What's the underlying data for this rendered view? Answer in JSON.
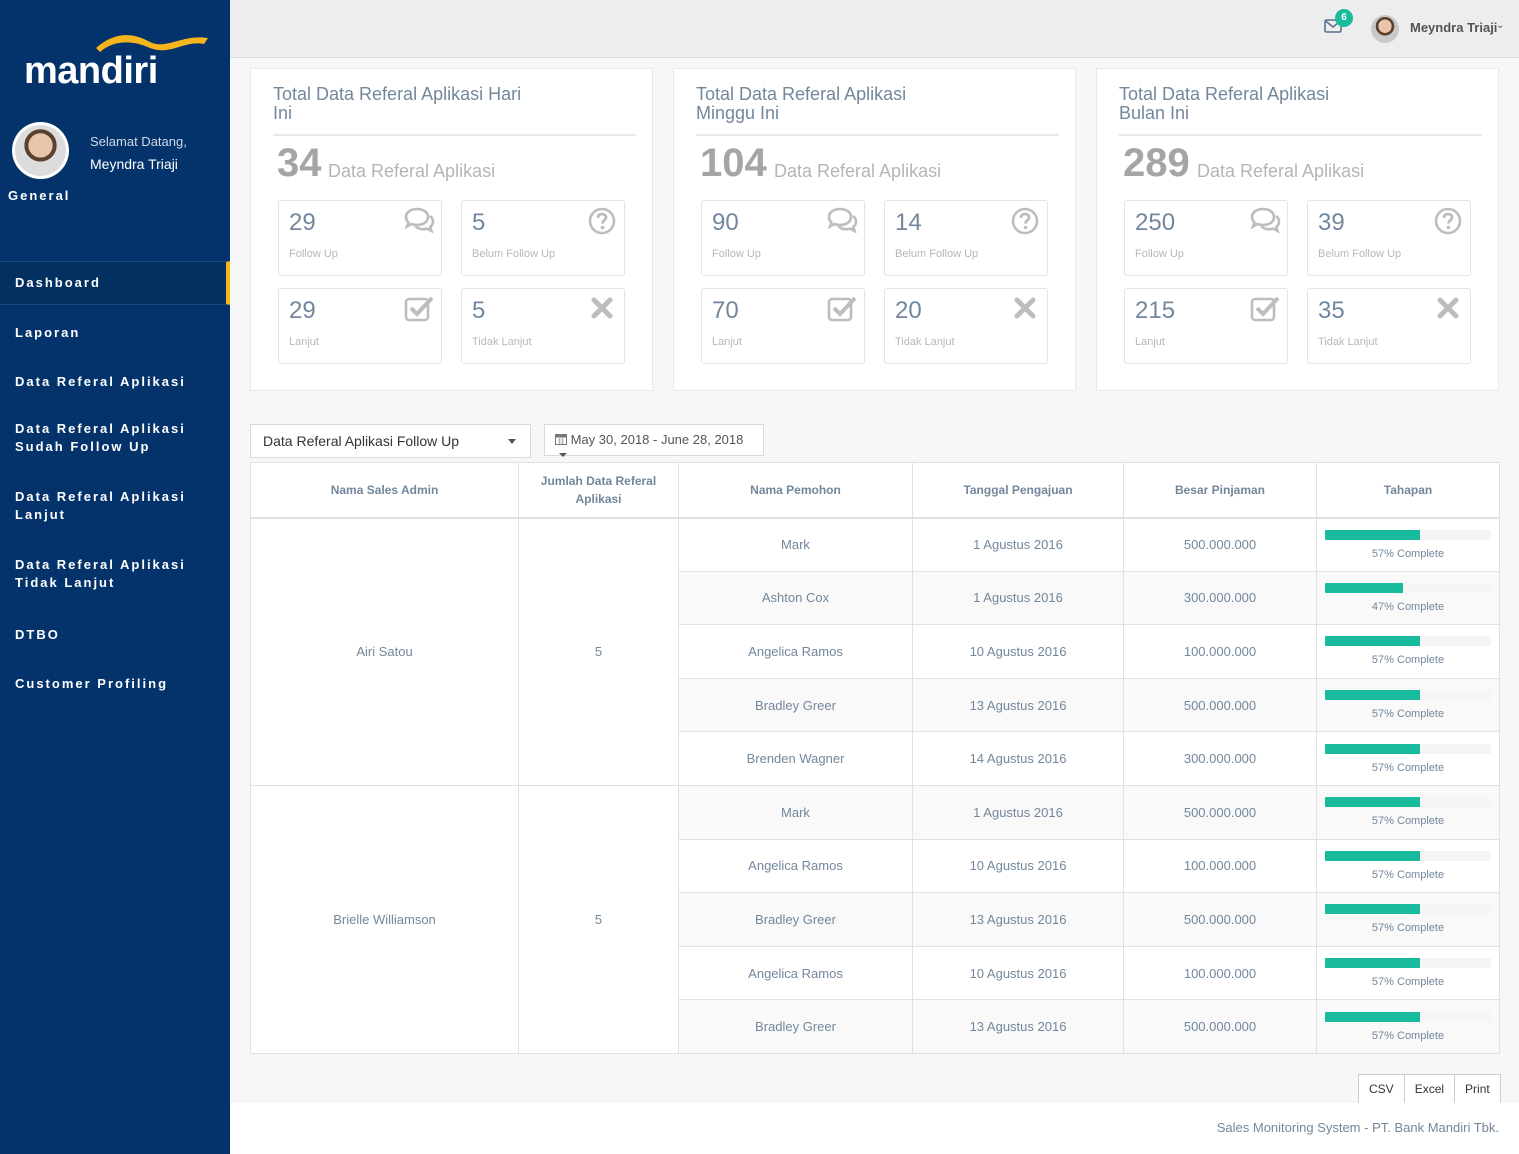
{
  "brand": {
    "logo_text": "mandiri"
  },
  "profile": {
    "welcome": "Selamat Datang,",
    "name": "Meyndra Triaji"
  },
  "sidebar": {
    "section_title": "General",
    "items": [
      {
        "label": "Dashboard",
        "active": true
      },
      {
        "label": "Laporan"
      },
      {
        "label": "Data Referal Aplikasi"
      },
      {
        "label": "Data Referal Aplikasi Sudah Follow Up"
      },
      {
        "label": "Data Referal Aplikasi Lanjut"
      },
      {
        "label": "Data Referal Aplikasi Tidak Lanjut"
      },
      {
        "label": "DTBO"
      },
      {
        "label": "Customer Profiling"
      }
    ]
  },
  "topbar": {
    "mail_count": "6",
    "user_name": "Meyndra Triaji"
  },
  "panels": [
    {
      "title": "Total Data Referal Aplikasi Hari Ini",
      "total": "34",
      "total_label": "Data Referal Aplikasi",
      "tiles": [
        {
          "value": "29",
          "label": "Follow Up",
          "icon": "comments-icon"
        },
        {
          "value": "5",
          "label": "Belum Follow Up",
          "icon": "question-circle-icon"
        },
        {
          "value": "29",
          "label": "Lanjut",
          "icon": "check-square-icon"
        },
        {
          "value": "5",
          "label": "Tidak Lanjut",
          "icon": "close-icon"
        }
      ]
    },
    {
      "title": "Total Data Referal Aplikasi Minggu Ini",
      "total": "104",
      "total_label": "Data Referal Aplikasi",
      "tiles": [
        {
          "value": "90",
          "label": "Follow Up",
          "icon": "comments-icon"
        },
        {
          "value": "14",
          "label": "Belum Follow Up",
          "icon": "question-circle-icon"
        },
        {
          "value": "70",
          "label": "Lanjut",
          "icon": "check-square-icon"
        },
        {
          "value": "20",
          "label": "Tidak Lanjut",
          "icon": "close-icon"
        }
      ]
    },
    {
      "title": "Total Data Referal Aplikasi Bulan Ini",
      "total": "289",
      "total_label": "Data Referal Aplikasi",
      "tiles": [
        {
          "value": "250",
          "label": "Follow Up",
          "icon": "comments-icon"
        },
        {
          "value": "39",
          "label": "Belum Follow Up",
          "icon": "question-circle-icon"
        },
        {
          "value": "215",
          "label": "Lanjut",
          "icon": "check-square-icon"
        },
        {
          "value": "35",
          "label": "Tidak Lanjut",
          "icon": "close-icon"
        }
      ]
    }
  ],
  "filters": {
    "select_value": "Data Referal Aplikasi Follow Up",
    "date_range": "May 30, 2018 - June 28, 2018"
  },
  "table": {
    "headers": [
      "Nama Sales Admin",
      "Jumlah Data Referal Aplikasi",
      "Nama Pemohon",
      "Tanggal Pengajuan",
      "Besar Pinjaman",
      "Tahapan"
    ],
    "groups": [
      {
        "sales_admin": "Airi Satou",
        "count": "5",
        "rows": [
          {
            "pemohon": "Mark",
            "tanggal": "1 Agustus 2016",
            "pinjaman": "500.000.000",
            "progress": 57,
            "progress_label": "57% Complete"
          },
          {
            "pemohon": "Ashton Cox",
            "tanggal": "1 Agustus 2016",
            "pinjaman": "300.000.000",
            "progress": 47,
            "progress_label": "47% Complete"
          },
          {
            "pemohon": "Angelica Ramos",
            "tanggal": "10 Agustus 2016",
            "pinjaman": "100.000.000",
            "progress": 57,
            "progress_label": "57% Complete"
          },
          {
            "pemohon": "Bradley Greer",
            "tanggal": "13 Agustus 2016",
            "pinjaman": "500.000.000",
            "progress": 57,
            "progress_label": "57% Complete"
          },
          {
            "pemohon": "Brenden Wagner",
            "tanggal": "14 Agustus 2016",
            "pinjaman": "300.000.000",
            "progress": 57,
            "progress_label": "57% Complete"
          }
        ]
      },
      {
        "sales_admin": "Brielle Williamson",
        "count": "5",
        "rows": [
          {
            "pemohon": "Mark",
            "tanggal": "1 Agustus 2016",
            "pinjaman": "500.000.000",
            "progress": 57,
            "progress_label": "57% Complete"
          },
          {
            "pemohon": "Angelica Ramos",
            "tanggal": "10 Agustus 2016",
            "pinjaman": "100.000.000",
            "progress": 57,
            "progress_label": "57% Complete"
          },
          {
            "pemohon": "Bradley Greer",
            "tanggal": "13 Agustus 2016",
            "pinjaman": "500.000.000",
            "progress": 57,
            "progress_label": "57% Complete"
          },
          {
            "pemohon": "Angelica Ramos",
            "tanggal": "10 Agustus 2016",
            "pinjaman": "100.000.000",
            "progress": 57,
            "progress_label": "57% Complete"
          },
          {
            "pemohon": "Bradley Greer",
            "tanggal": "13 Agustus 2016",
            "pinjaman": "500.000.000",
            "progress": 57,
            "progress_label": "57% Complete"
          }
        ]
      }
    ]
  },
  "export_buttons": [
    "CSV",
    "Excel",
    "Print"
  ],
  "footer": {
    "text": "Sales Monitoring System - PT. Bank Mandiri Tbk."
  },
  "colors": {
    "sidebar": "#04336b",
    "accent": "#1abb9c",
    "active_marker": "#f5b61c"
  }
}
